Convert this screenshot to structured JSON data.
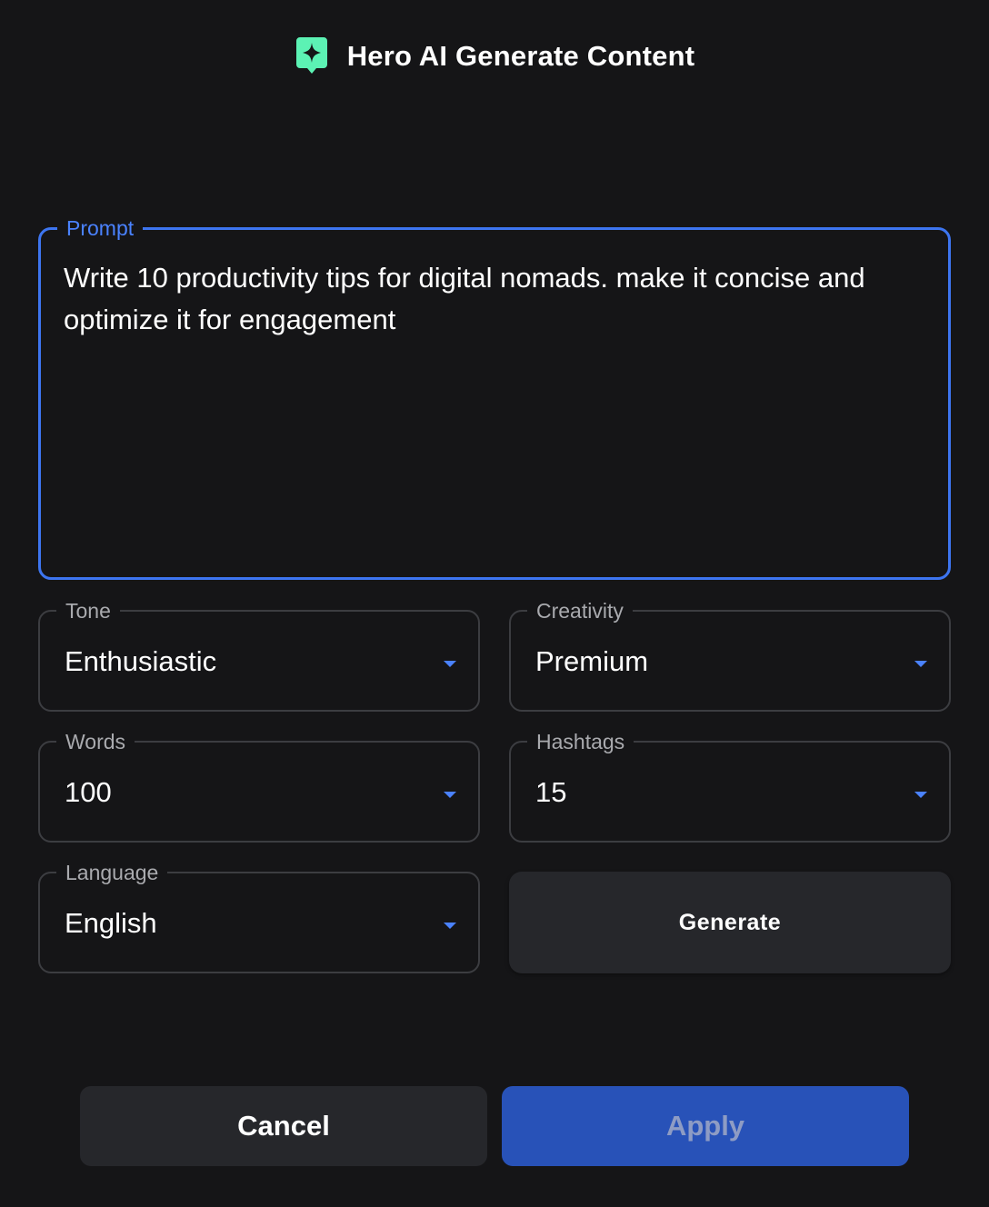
{
  "header": {
    "title": "Hero AI Generate Content",
    "logo_icon": "sparkle-chat-icon",
    "logo_color": "#5cf2b4"
  },
  "prompt": {
    "label": "Prompt",
    "value": "Write 10 productivity tips for digital nomads. make it concise and optimize it for engagement"
  },
  "fields": {
    "tone": {
      "label": "Tone",
      "value": "Enthusiastic"
    },
    "creativity": {
      "label": "Creativity",
      "value": "Premium"
    },
    "words": {
      "label": "Words",
      "value": "100"
    },
    "hashtags": {
      "label": "Hashtags",
      "value": "15"
    },
    "language": {
      "label": "Language",
      "value": "English"
    }
  },
  "actions": {
    "generate_label": "Generate",
    "cancel_label": "Cancel",
    "apply_label": "Apply"
  },
  "colors": {
    "background": "#151517",
    "accent": "#3d75f0",
    "apply_button": "#2852b8",
    "secondary_button": "#26272b"
  }
}
